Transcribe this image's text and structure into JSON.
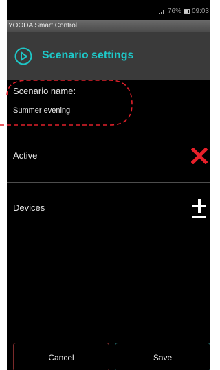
{
  "status_bar": {
    "battery_percent": "76%",
    "time": "09:03"
  },
  "app": {
    "title": "YOODA Smart Control"
  },
  "header": {
    "title": "Scenario settings",
    "accent_color": "#1ec8c8"
  },
  "form": {
    "name_label": "Scenario name:",
    "name_value": "Summer evening",
    "active_label": "Active",
    "active_icon": "close-icon",
    "devices_label": "Devices",
    "devices_icon": "plus-minus-icon"
  },
  "buttons": {
    "cancel_label": "Cancel",
    "save_label": "Save"
  }
}
